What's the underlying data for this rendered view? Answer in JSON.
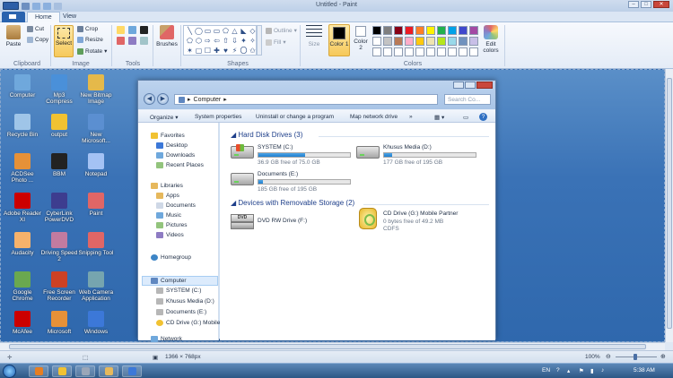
{
  "paint": {
    "title": "Untitled - Paint",
    "tabs": {
      "file": "",
      "home": "Home",
      "view": "View"
    },
    "clipboard": {
      "paste": "Paste",
      "cut": "Cut",
      "copy": "Copy",
      "group": "Clipboard"
    },
    "image": {
      "select": "Select",
      "crop": "Crop",
      "resize": "Resize",
      "rotate": "Rotate",
      "group": "Image"
    },
    "tools": {
      "group": "Tools"
    },
    "brushes": "Brushes",
    "shapes": {
      "outline": "Outline",
      "fill": "Fill",
      "group": "Shapes",
      "glyphs": [
        "╲",
        "◯",
        "▭",
        "▭",
        "⬠",
        "△",
        "◣",
        "◇",
        "⬠",
        "⬡",
        "⇨",
        "⇦",
        "⇧",
        "⇩",
        "✦",
        "✧",
        "✶",
        "▢",
        "☐",
        "✚",
        "♥",
        "⚡",
        "〇",
        "✩"
      ]
    },
    "size": "Size",
    "color1": "Color 1",
    "color2": "Color 2",
    "colors_group": "Colors",
    "edit_colors": "Edit colors",
    "palette": [
      "#000000",
      "#7f7f7f",
      "#880015",
      "#ed1c24",
      "#ff7f27",
      "#fff200",
      "#22b14c",
      "#00a2e8",
      "#3f48cc",
      "#a349a4",
      "#ffffff",
      "#c3c3c3",
      "#b97a57",
      "#ffaec9",
      "#ffc90e",
      "#efe4b0",
      "#b5e61d",
      "#99d9ea",
      "#7092be",
      "#c8bfe7",
      "#ffffff",
      "#ffffff",
      "#ffffff",
      "#ffffff",
      "#ffffff",
      "#ffffff",
      "#ffffff",
      "#ffffff",
      "#ffffff",
      "#ffffff"
    ],
    "status": {
      "dimensions": "1366 × 768px",
      "zoom": "100%"
    }
  },
  "desktop": {
    "icons": [
      {
        "label": "Computer",
        "color": "#6fa8dc"
      },
      {
        "label": "Mp3 Compress",
        "color": "#4a90d9"
      },
      {
        "label": "New Bitmap Image",
        "color": "#e5b94a"
      },
      {
        "label": "Recycle Bin",
        "color": "#9fc5e8"
      },
      {
        "label": "output",
        "color": "#f1c232"
      },
      {
        "label": "New Microsoft...",
        "color": "#5b8fd1"
      },
      {
        "label": "ACDSee Photo ...",
        "color": "#e69138"
      },
      {
        "label": "BBM",
        "color": "#222222"
      },
      {
        "label": "Notepad",
        "color": "#a4c2f4"
      },
      {
        "label": "Adobe Reader XI",
        "color": "#cc0000"
      },
      {
        "label": "CyberLink PowerDVD",
        "color": "#3d3d8f"
      },
      {
        "label": "Paint",
        "color": "#e06666"
      },
      {
        "label": "Audacity",
        "color": "#f6b26b"
      },
      {
        "label": "Driving Speed 2",
        "color": "#c27ba0"
      },
      {
        "label": "Snipping Tool",
        "color": "#e06666"
      },
      {
        "label": "Google Chrome",
        "color": "#6aa84f"
      },
      {
        "label": "Free Screen Recorder",
        "color": "#cc4125"
      },
      {
        "label": "Web Camera Application",
        "color": "#76a5af"
      },
      {
        "label": "McAfee",
        "color": "#cc0000"
      },
      {
        "label": "Microsoft",
        "color": "#e69138"
      },
      {
        "label": "Windows",
        "color": "#3c78d8"
      }
    ]
  },
  "explorer": {
    "address": "Computer",
    "search_placeholder": "Search Co...",
    "toolbar": {
      "organize": "Organize",
      "system_properties": "System properties",
      "uninstall": "Uninstall or change a program",
      "map_drive": "Map network drive"
    },
    "nav": {
      "favorites": "Favorites",
      "desktop": "Desktop",
      "downloads": "Downloads",
      "recent": "Recent Places",
      "libraries": "Libraries",
      "apps": "Apps",
      "documents": "Documents",
      "music": "Music",
      "pictures": "Pictures",
      "videos": "Videos",
      "homegroup": "Homegroup",
      "computer": "Computer",
      "system_c": "SYSTEM (C:)",
      "khusus_d": "Khusus Media (D:)",
      "documents_e": "Documents (E:)",
      "cd_g": "CD Drive (G:) Mobile",
      "network": "Network"
    },
    "hdd_section": "Hard Disk Drives (3)",
    "removable_section": "Devices with Removable Storage (2)",
    "drives": [
      {
        "name": "SYSTEM (C:)",
        "free": "36.9 GB free of 75.0 GB",
        "used": 0.51
      },
      {
        "name": "Khusus Media (D:)",
        "free": "177 GB free of 195 GB",
        "used": 0.09
      },
      {
        "name": "Documents (E:)",
        "free": "185 GB free of 195 GB",
        "used": 0.05
      }
    ],
    "dvd": {
      "name": "DVD RW Drive (F:)",
      "label": "DVD"
    },
    "cd": {
      "name": "CD Drive (G:) Mobile Partner",
      "free": "0 bytes free of 49.2 MB",
      "fs": "CDFS"
    }
  },
  "taskbar": {
    "lang": "EN",
    "time": "5:38 AM"
  }
}
